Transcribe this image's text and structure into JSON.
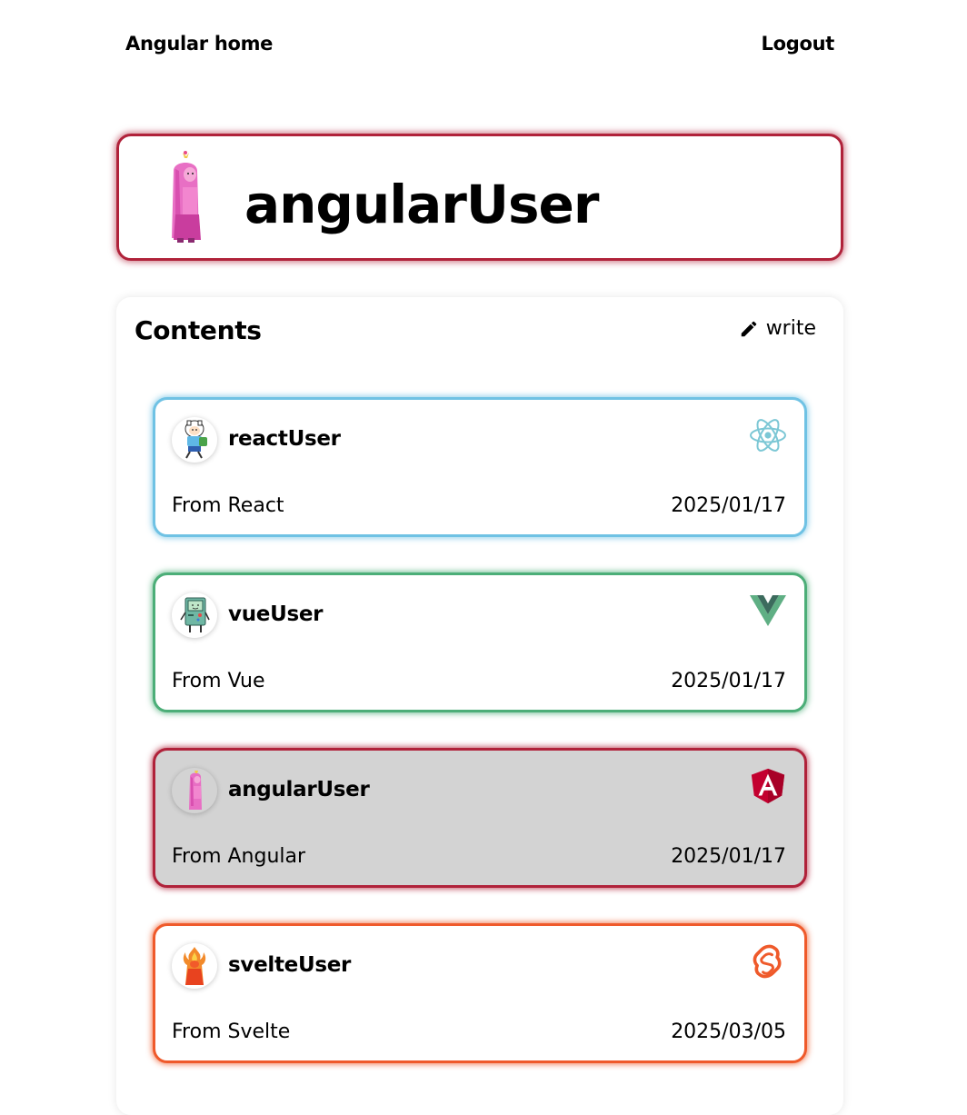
{
  "nav": {
    "home_label": "Angular home",
    "logout_label": "Logout"
  },
  "profile": {
    "username": "angularUser",
    "avatar": "princess-bubblegum-character"
  },
  "contents": {
    "title": "Contents",
    "write_label": "write",
    "write_icon": "pencil-icon",
    "items": [
      {
        "username": "reactUser",
        "avatar": "finn-character",
        "framework_icon": "react-logo-icon",
        "border_color": "#6fc2e4",
        "background": "#ffffff",
        "message": "From React",
        "date": "2025/01/17"
      },
      {
        "username": "vueUser",
        "avatar": "bmo-character",
        "framework_icon": "vue-logo-icon",
        "border_color": "#4cae78",
        "background": "#ffffff",
        "message": "From Vue",
        "date": "2025/01/17"
      },
      {
        "username": "angularUser",
        "avatar": "princess-bubblegum-character",
        "framework_icon": "angular-logo-icon",
        "border_color": "#b0223a",
        "background": "#d3d3d3",
        "message": "From Angular",
        "date": "2025/01/17"
      },
      {
        "username": "svelteUser",
        "avatar": "flame-princess-character",
        "framework_icon": "svelte-logo-icon",
        "border_color": "#ef5a2b",
        "background": "#ffffff",
        "message": "From Svelte",
        "date": "2025/03/05"
      }
    ]
  }
}
